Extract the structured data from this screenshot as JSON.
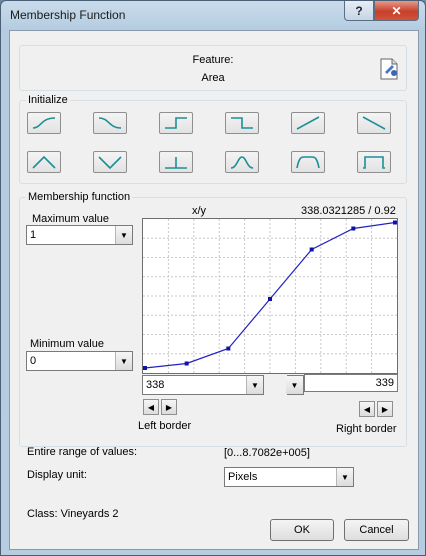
{
  "window": {
    "title": "Membership Function",
    "help": "?",
    "close": "✕"
  },
  "feature": {
    "label": "Feature:",
    "value": "Area"
  },
  "initialize": {
    "title": "Initialize",
    "shapes": [
      "s-curve-up",
      "s-curve-down",
      "step-up",
      "step-down",
      "ramp-up",
      "ramp-down",
      "triangle",
      "v-shape",
      "single-value",
      "gaussian",
      "trapezoid",
      "rectangle"
    ]
  },
  "mf": {
    "title": "Membership function",
    "max_label": "Maximum value",
    "max_value": "1",
    "min_label": "Minimum value",
    "min_value": "0",
    "xy_label": "x/y",
    "xy_value": "338.0321285 / 0.92",
    "left_value": "338",
    "right_value": "339",
    "left_border": "Left border",
    "right_border": "Right border",
    "range_label": "Entire range of values:",
    "range_value": "[0...8.7082e+005]",
    "unit_label": "Display unit:",
    "unit_value": "Pixels"
  },
  "chart_data": {
    "type": "line",
    "x": [
      0,
      1,
      2,
      3,
      4,
      5,
      6
    ],
    "y": [
      0.02,
      0.05,
      0.15,
      0.48,
      0.81,
      0.95,
      0.99
    ],
    "ylim": [
      0,
      1
    ],
    "grid": true
  },
  "footer": {
    "class_text": "Class: Vineyards 2",
    "ok": "OK",
    "cancel": "Cancel"
  }
}
